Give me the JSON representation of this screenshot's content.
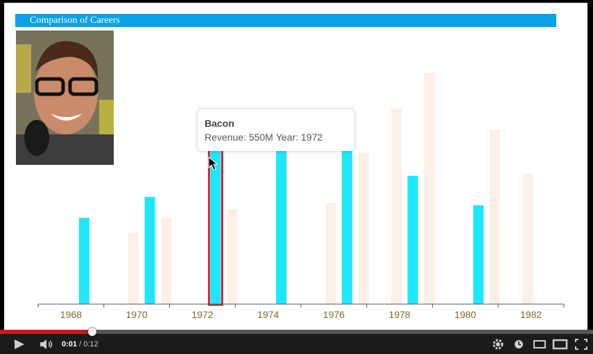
{
  "video": {
    "title_bar": "Comparison of Careers",
    "photo_alt": "Kevin Bacon photo",
    "tooltip": {
      "name": "Bacon",
      "revenue_label": "Revenue: 550M",
      "year_label": "Year: 1972"
    }
  },
  "chart_data": {
    "type": "bar",
    "title": "Comparison of Careers",
    "xlabel": "",
    "ylabel": "",
    "xlim": [
      1967,
      1983
    ],
    "ticks": [
      "1968",
      "1970",
      "1972",
      "1974",
      "1976",
      "1978",
      "1980",
      "1982"
    ],
    "ylim": [
      0,
      1100
    ],
    "series": [
      {
        "name": "Bacon",
        "color": "#1ee6fb",
        "x": [
          1968.4,
          1970.4,
          1972.4,
          1974.4,
          1976.4,
          1978.4,
          1980.4
        ],
        "values": [
          410,
          510,
          770,
          880,
          800,
          610,
          470
        ]
      },
      {
        "color": "#fdeee6",
        "x": [
          1969.9,
          1970.9,
          1972.9,
          1975.9,
          1976.9,
          1977.9,
          1978.9,
          1980.9,
          1981.9
        ],
        "values": [
          340,
          410,
          450,
          480,
          720,
          930,
          1100,
          830,
          620
        ]
      }
    ],
    "highlight": {
      "series": "Bacon",
      "x": 1972.4
    }
  },
  "player": {
    "current_time": "0:01",
    "duration": "/ 0:12",
    "progress_played": 0.155,
    "progress_loaded": 0.16,
    "colors": {
      "played": "#cc181e",
      "bar_bg": "#1b1b1b"
    },
    "icons": [
      "play-icon",
      "volume-icon",
      "settings-icon",
      "watch-later-icon",
      "small-player-icon",
      "theater-mode-icon",
      "fullscreen-icon"
    ]
  }
}
